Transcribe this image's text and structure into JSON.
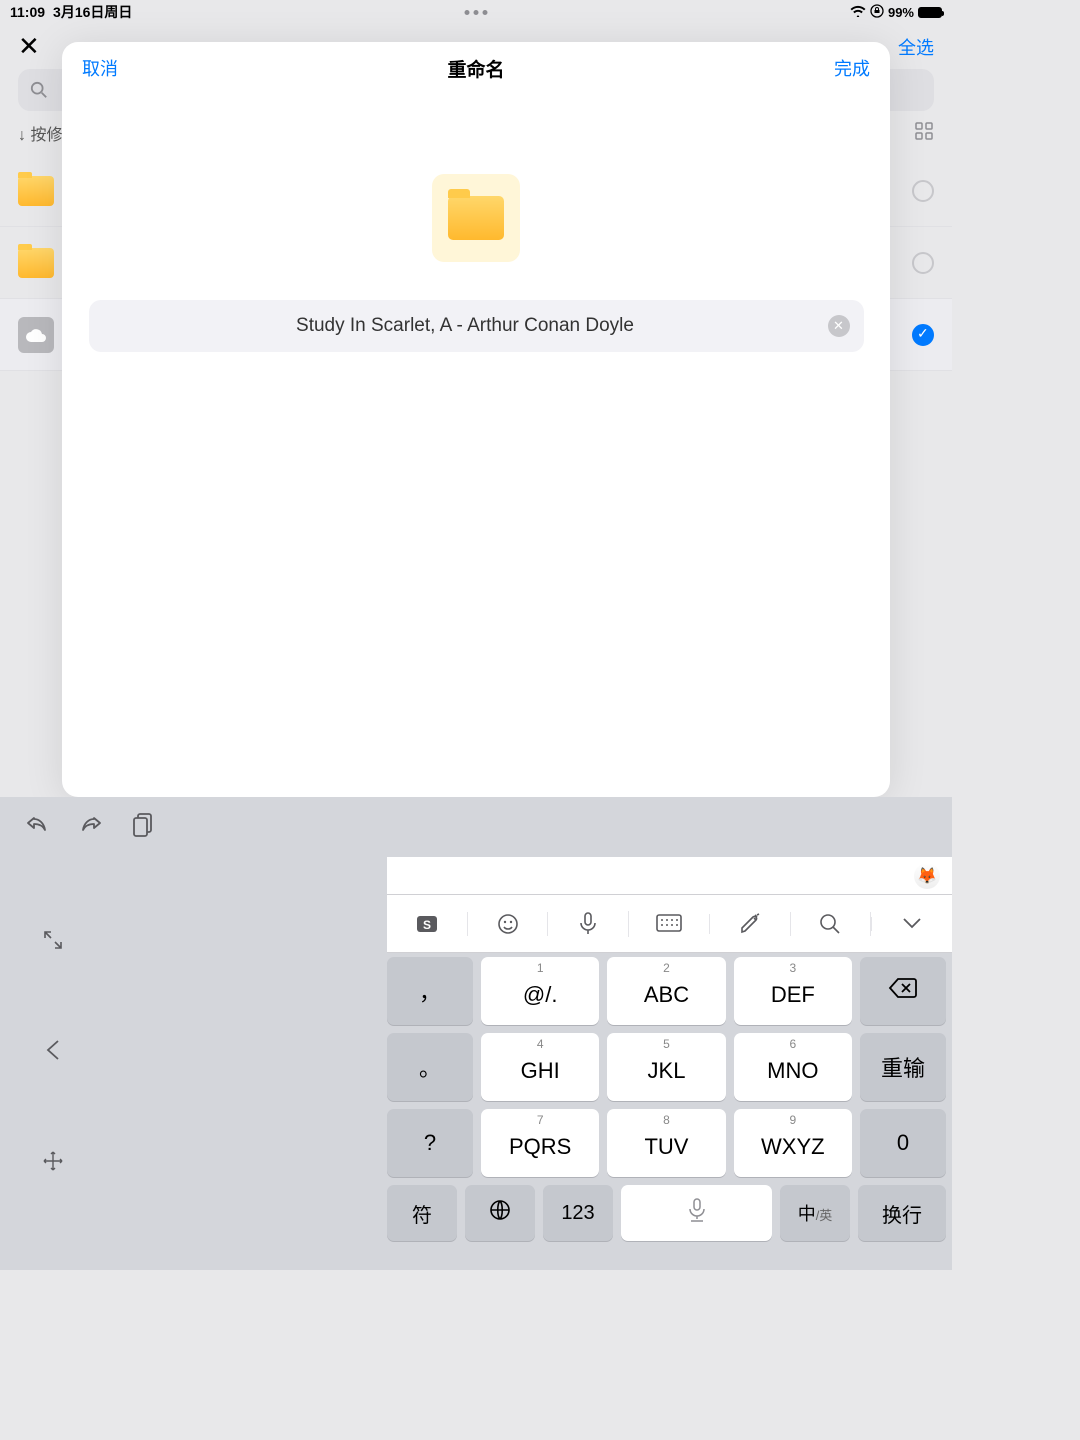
{
  "status": {
    "time": "11:09",
    "date": "3月16日周日",
    "battery_pct": "99%"
  },
  "bg": {
    "select_all": "全选",
    "sort_label": "↓ 按修"
  },
  "modal": {
    "cancel": "取消",
    "title": "重命名",
    "done": "完成",
    "input_value": "Study In Scarlet, A - Arthur Conan Doyle"
  },
  "keyboard": {
    "keys": {
      "k1": {
        "num": "1",
        "lbl": "@/."
      },
      "k2": {
        "num": "2",
        "lbl": "ABC"
      },
      "k3": {
        "num": "3",
        "lbl": "DEF"
      },
      "k4": {
        "num": "4",
        "lbl": "GHI"
      },
      "k5": {
        "num": "5",
        "lbl": "JKL"
      },
      "k6": {
        "num": "6",
        "lbl": "MNO"
      },
      "k7": {
        "num": "7",
        "lbl": "PQRS"
      },
      "k8": {
        "num": "8",
        "lbl": "TUV"
      },
      "k9": {
        "num": "9",
        "lbl": "WXYZ"
      }
    },
    "punc": {
      "comma": "，",
      "dot": "。",
      "question": "?"
    },
    "actions": {
      "reinput": "重输",
      "zero": "0",
      "enter": "换行"
    },
    "bottom": {
      "sym": "符",
      "num": "123",
      "lang_main": "中",
      "lang_sub": "/英"
    }
  }
}
